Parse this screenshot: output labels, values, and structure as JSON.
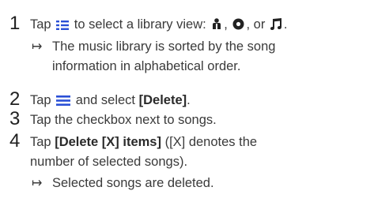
{
  "steps": [
    {
      "number": "1",
      "text_prefix": "Tap",
      "text_mid": "to select a library view:",
      "sep1": ",",
      "sep2": ", or",
      "end": ".",
      "icons": [
        "library-view-icon",
        "artist-icon",
        "album-icon",
        "song-icon"
      ],
      "result_line1": "The music library is sorted by the song",
      "result_line2": "information in alphabetical order."
    },
    {
      "number": "2",
      "text_prefix": "Tap",
      "text_mid": "and select",
      "bold": "[Delete]",
      "end": ".",
      "icons": [
        "menu-icon"
      ]
    },
    {
      "number": "3",
      "text": "Tap the checkbox next to songs."
    },
    {
      "number": "4",
      "text_prefix": "Tap",
      "bold": "[Delete [X] items]",
      "text_suffix": "([X] denotes the",
      "line2": "number of selected songs).",
      "result": "Selected songs are deleted."
    }
  ],
  "colors": {
    "icon_blue": "#2a4fd6",
    "text": "#3a3a3a"
  }
}
